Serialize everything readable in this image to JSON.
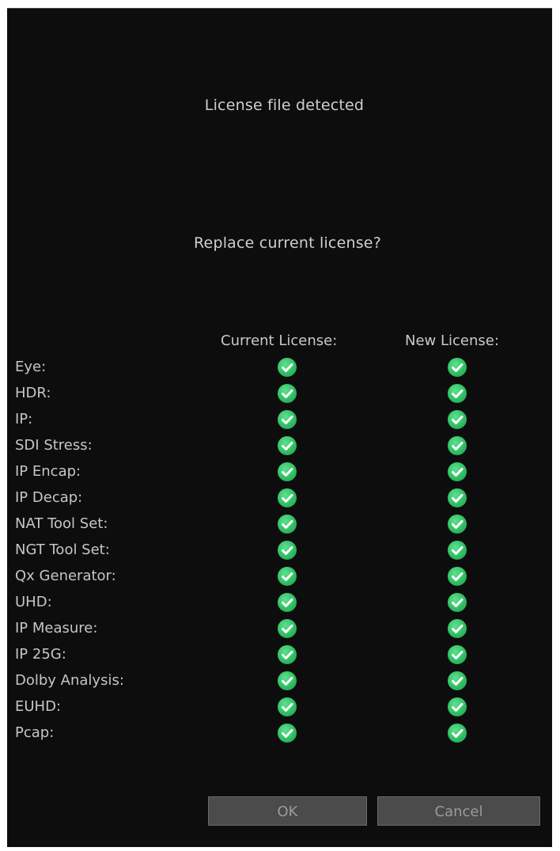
{
  "dialog": {
    "title": "License file detected",
    "question": "Replace current license?",
    "columns": {
      "current": "Current License:",
      "new": "New License:"
    },
    "features": [
      {
        "label": "Eye:",
        "current": true,
        "new": true
      },
      {
        "label": "HDR:",
        "current": true,
        "new": true
      },
      {
        "label": "IP:",
        "current": true,
        "new": true
      },
      {
        "label": "SDI Stress:",
        "current": true,
        "new": true
      },
      {
        "label": "IP Encap:",
        "current": true,
        "new": true
      },
      {
        "label": "IP Decap:",
        "current": true,
        "new": true
      },
      {
        "label": "NAT Tool Set:",
        "current": true,
        "new": true
      },
      {
        "label": "NGT Tool Set:",
        "current": true,
        "new": true
      },
      {
        "label": "Qx Generator:",
        "current": true,
        "new": true
      },
      {
        "label": "UHD:",
        "current": true,
        "new": true
      },
      {
        "label": "IP Measure:",
        "current": true,
        "new": true
      },
      {
        "label": "IP 25G:",
        "current": true,
        "new": true
      },
      {
        "label": "Dolby Analysis:",
        "current": true,
        "new": true
      },
      {
        "label": "EUHD:",
        "current": true,
        "new": true
      },
      {
        "label": "Pcap:",
        "current": true,
        "new": true
      }
    ],
    "buttons": {
      "ok": "OK",
      "cancel": "Cancel"
    },
    "check_icon": "check-circle-icon",
    "colors": {
      "background": "#0d0d0d",
      "check_green": "#2fbf63",
      "button_bg": "#4b4b4b"
    }
  }
}
